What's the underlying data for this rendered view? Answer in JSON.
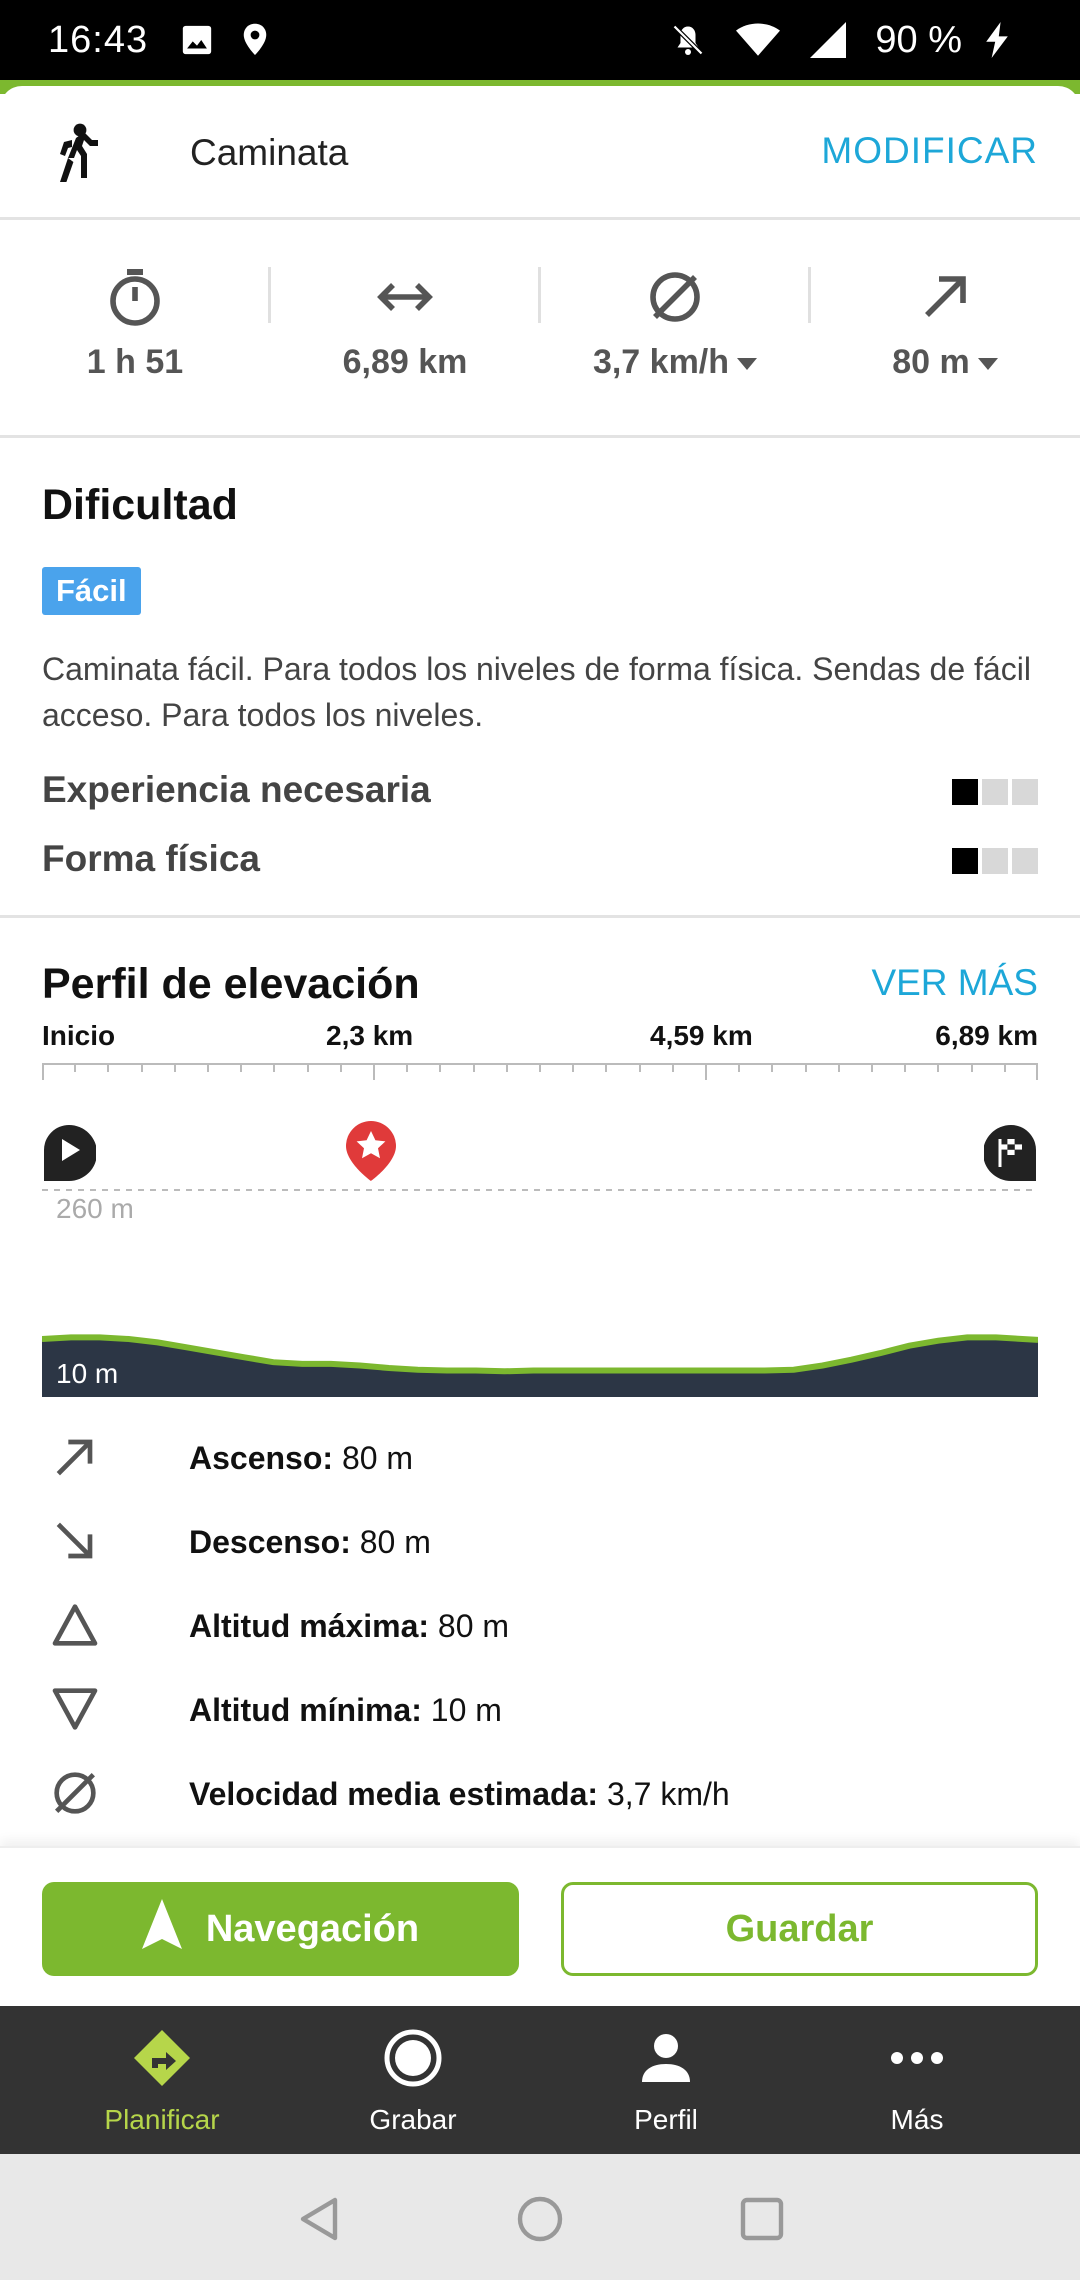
{
  "status_bar": {
    "time": "16:43",
    "battery": "90 %",
    "icons": [
      "image-icon",
      "location-icon",
      "bell-off-icon",
      "wifi-icon",
      "signal-icon",
      "charging-icon"
    ]
  },
  "activity": {
    "icon": "hiking-icon",
    "label": "Caminata",
    "modify_label": "MODIFICAR"
  },
  "stats": [
    {
      "icon": "timer-icon",
      "value": "1 h 51",
      "dropdown": false
    },
    {
      "icon": "distance-icon",
      "value": "6,89 km",
      "dropdown": false
    },
    {
      "icon": "average-speed-icon",
      "value": "3,7 km/h",
      "dropdown": true
    },
    {
      "icon": "ascent-icon",
      "value": "80 m",
      "dropdown": true
    }
  ],
  "difficulty": {
    "title": "Dificultad",
    "badge": "Fácil",
    "description": "Caminata fácil. Para todos los niveles de forma física. Sendas de fácil acceso. Para todos los niveles.",
    "ratings": [
      {
        "label": "Experiencia necesaria",
        "filled": 1,
        "max": 3
      },
      {
        "label": "Forma física",
        "filled": 1,
        "max": 3
      }
    ]
  },
  "elevation": {
    "title": "Perfil de elevación",
    "see_more": "VER MÁS",
    "ruler_labels": [
      "Inicio",
      "2,3 km",
      "4,59 km",
      "6,89 km"
    ],
    "max_label": "260 m",
    "min_label": "10 m",
    "chart_data": {
      "type": "area",
      "x": [
        0,
        0.2,
        0.4,
        0.6,
        0.8,
        1.0,
        1.2,
        1.4,
        1.6,
        1.8,
        2.0,
        2.2,
        2.4,
        2.6,
        2.8,
        3.0,
        3.2,
        3.4,
        3.6,
        3.8,
        4.0,
        4.2,
        4.4,
        4.6,
        4.8,
        5.0,
        5.2,
        5.4,
        5.6,
        5.8,
        6.0,
        6.2,
        6.4,
        6.6,
        6.89
      ],
      "y": [
        80,
        82,
        82,
        80,
        76,
        70,
        64,
        58,
        52,
        50,
        50,
        48,
        45,
        43,
        42,
        42,
        41,
        42,
        42,
        42,
        42,
        42,
        42,
        42,
        42,
        42,
        43,
        48,
        55,
        63,
        72,
        78,
        82,
        82,
        79
      ],
      "xlim": [
        0,
        6.89
      ],
      "ylim": [
        10,
        260
      ],
      "xlabel": "",
      "ylabel": ""
    }
  },
  "details": [
    {
      "icon": "ascent-icon",
      "label": "Ascenso:",
      "value": "80 m"
    },
    {
      "icon": "descent-icon",
      "label": "Descenso:",
      "value": "80 m"
    },
    {
      "icon": "max-altitude-icon",
      "label": "Altitud máxima:",
      "value": "80 m"
    },
    {
      "icon": "min-altitude-icon",
      "label": "Altitud mínima:",
      "value": "10 m"
    },
    {
      "icon": "average-speed-icon",
      "label": "Velocidad media estimada:",
      "value": "3,7 km/h"
    }
  ],
  "actions": {
    "navigate_label": "Navegación",
    "save_label": "Guardar"
  },
  "bottom_nav": [
    {
      "label": "Planificar",
      "icon": "route-icon",
      "active": true
    },
    {
      "label": "Grabar",
      "icon": "record-icon",
      "active": false
    },
    {
      "label": "Perfil",
      "icon": "profile-icon",
      "active": false
    },
    {
      "label": "Más",
      "icon": "more-icon",
      "active": false
    }
  ],
  "colors": {
    "accent_green": "#7cb82f",
    "link_blue": "#1da7d8",
    "badge_blue": "#4aa3ec",
    "chart_fill": "#2c3645",
    "nav_active": "#b6d64a"
  }
}
